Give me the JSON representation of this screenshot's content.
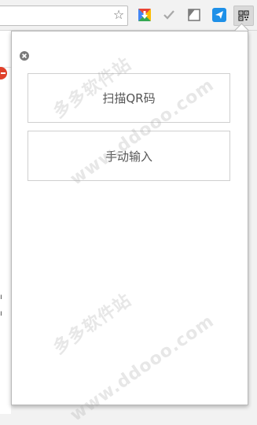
{
  "toolbar": {
    "bookmark_icon": "star-outline-icon",
    "extensions": [
      {
        "name": "google-drive-download-icon",
        "color": "#1a8b3e"
      },
      {
        "name": "checkmark-icon",
        "color": "#a8a8a8"
      },
      {
        "name": "page-corner-icon",
        "color": "#8a8a8a"
      },
      {
        "name": "plane-icon",
        "color": "#1e90e8"
      },
      {
        "name": "qr-code-icon",
        "color": "#333333"
      }
    ]
  },
  "popup": {
    "close_icon": "close-circle-icon",
    "scan_button_label": "扫描QR码",
    "manual_button_label": "手动输入"
  },
  "watermarks": [
    "多多软件站",
    "www.ddooo.com",
    "多多软件站",
    "www.ddooo.com"
  ],
  "colors": {
    "popup_border": "#b9b9b9",
    "button_border": "#cfcfcf",
    "button_text": "#555555",
    "close_icon": "#7a7a7a"
  }
}
